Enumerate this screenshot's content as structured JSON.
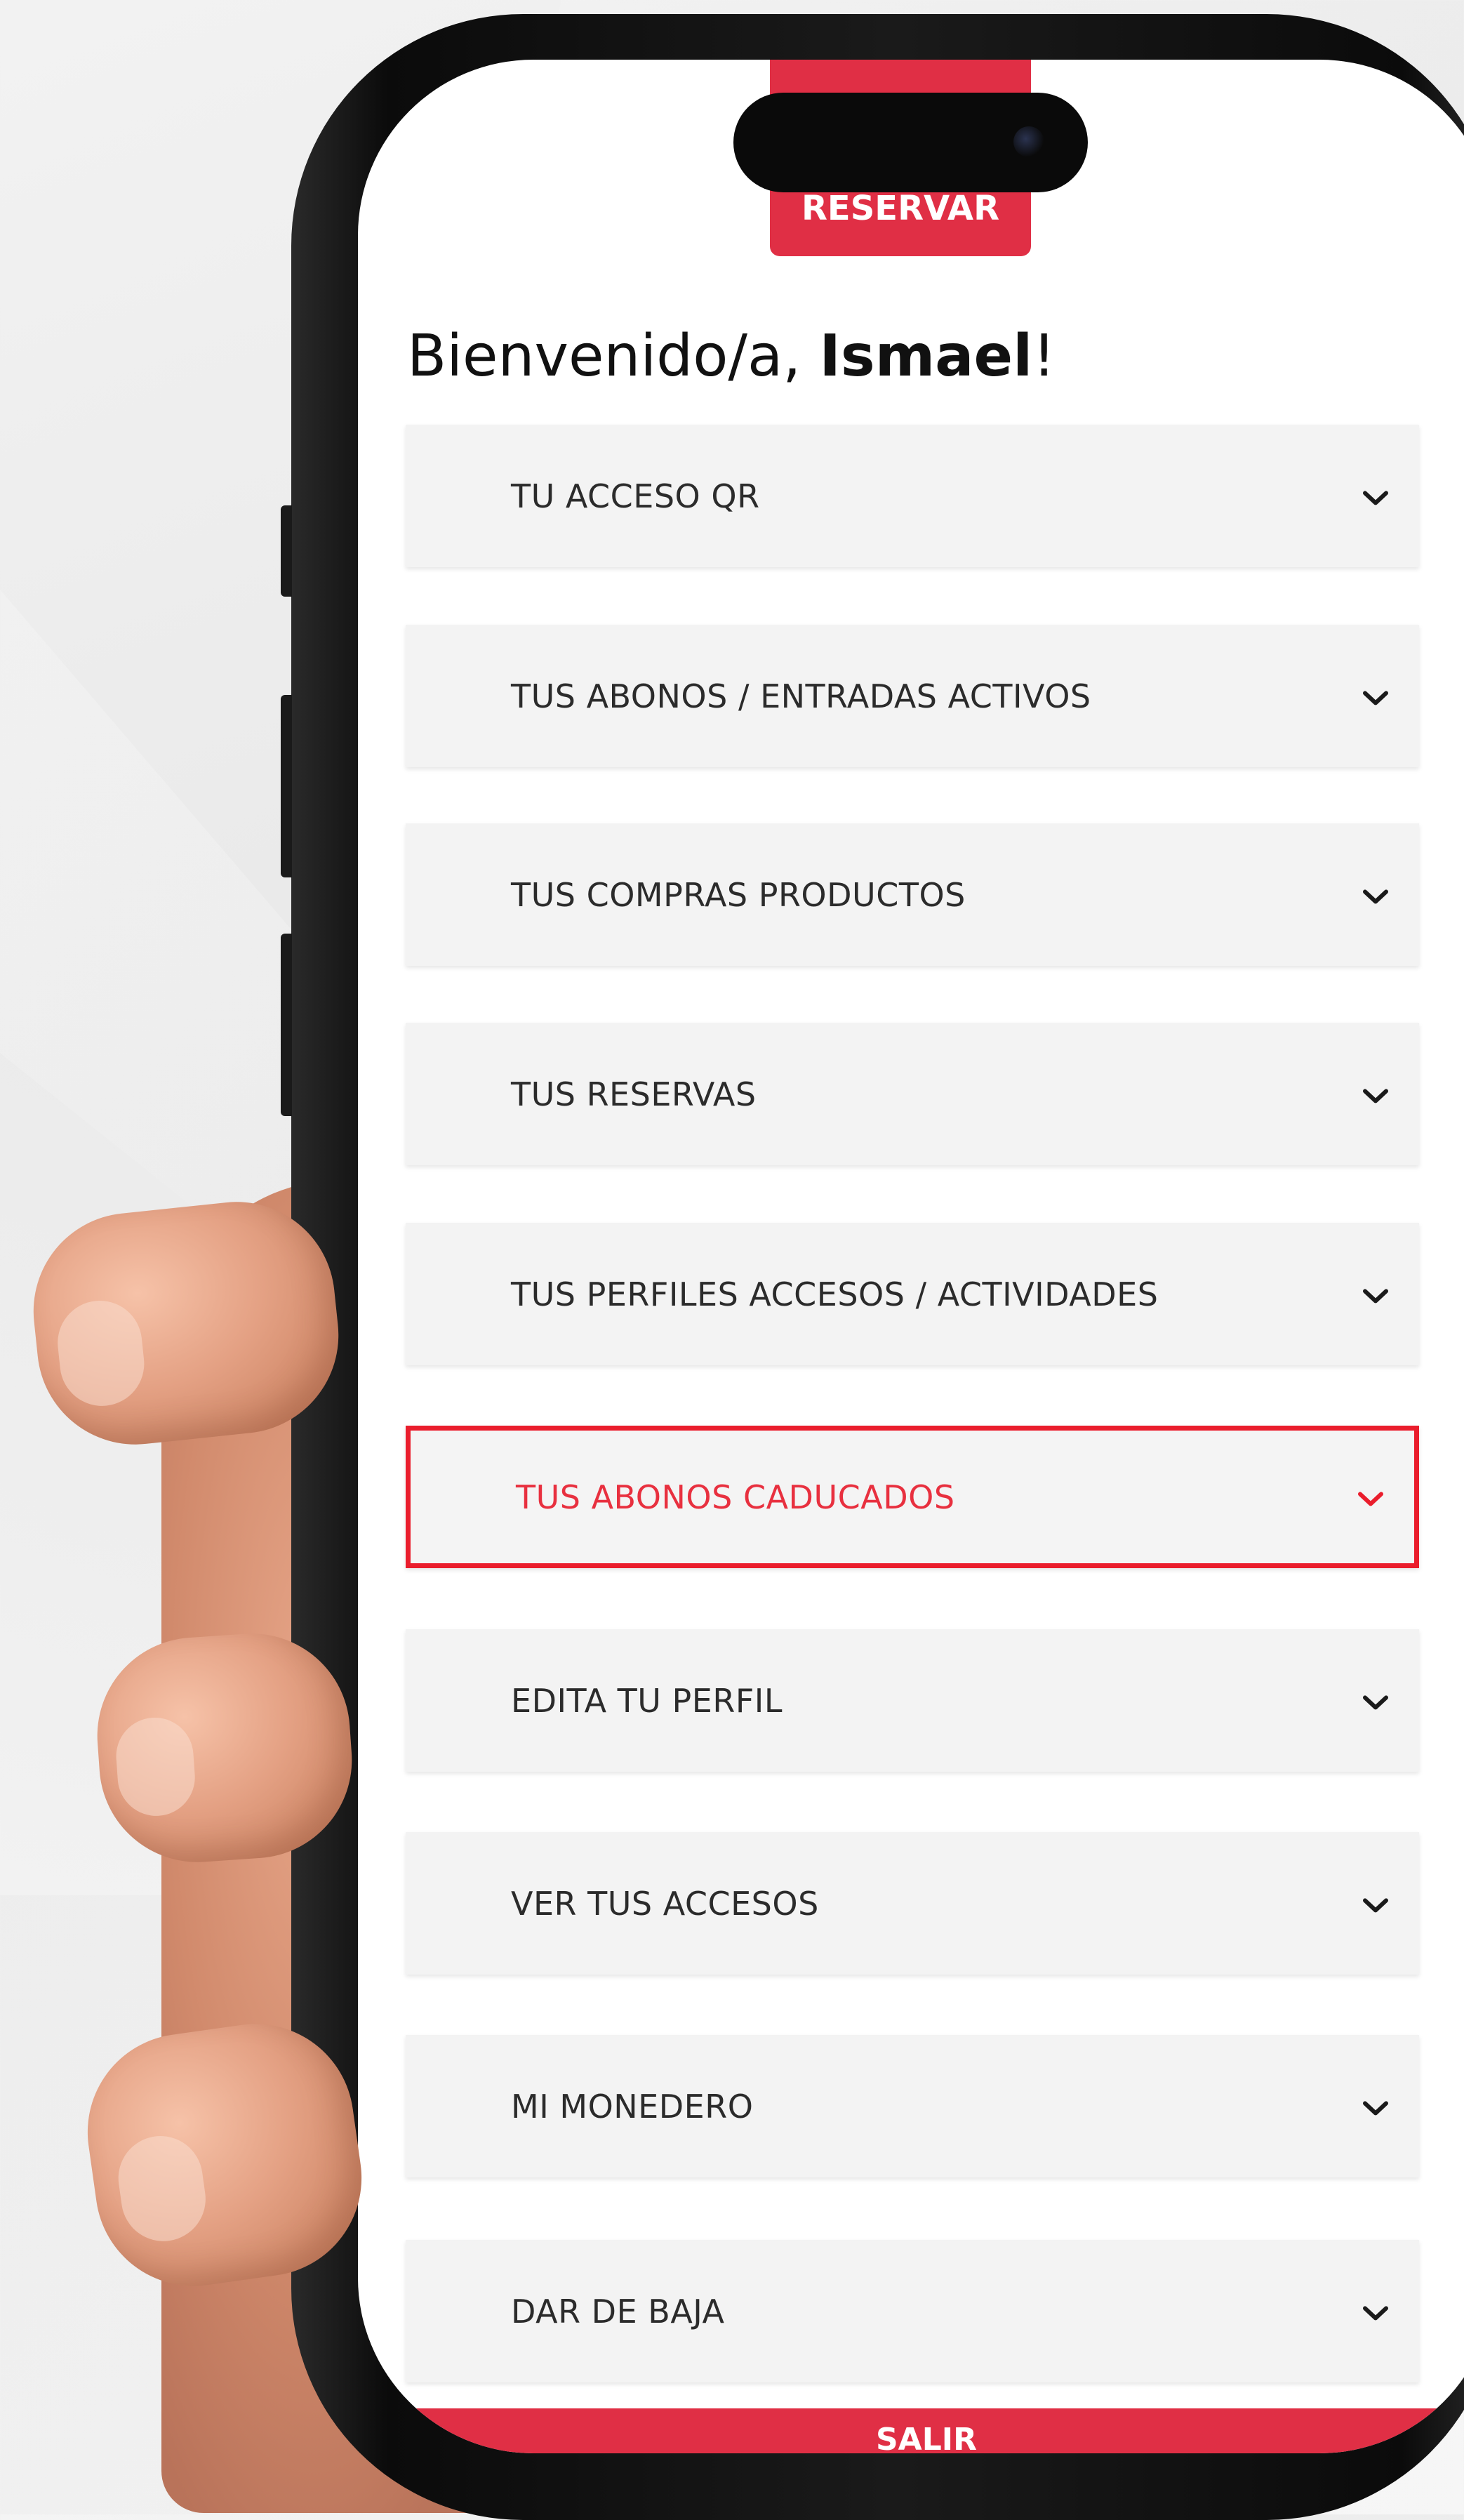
{
  "header": {
    "reserve_label": "RESERVAR"
  },
  "welcome": {
    "greeting": "Bienvenido/a, ",
    "user_name": "Ismael",
    "punct": "!"
  },
  "menu": {
    "items": [
      {
        "label": "TU ACCESO QR"
      },
      {
        "label": "TUS ABONOS / ENTRADAS ACTIVOS"
      },
      {
        "label": "TUS COMPRAS PRODUCTOS"
      },
      {
        "label": "TUS RESERVAS"
      },
      {
        "label": "TUS PERFILES ACCESOS / ACTIVIDADES"
      },
      {
        "label": "TUS ABONOS CADUCADOS",
        "highlighted": true
      },
      {
        "label": "EDITA TU PERFIL"
      },
      {
        "label": "VER TUS ACCESOS"
      },
      {
        "label": "MI MONEDERO"
      },
      {
        "label": "DAR DE BAJA"
      }
    ]
  },
  "footer": {
    "logout_label": "SALIR"
  },
  "icons": {
    "expand": "chevron-down-icon"
  },
  "colors": {
    "accent": "#e02f45",
    "highlight": "#ea1d2c",
    "item_bg": "#f3f3f3"
  }
}
